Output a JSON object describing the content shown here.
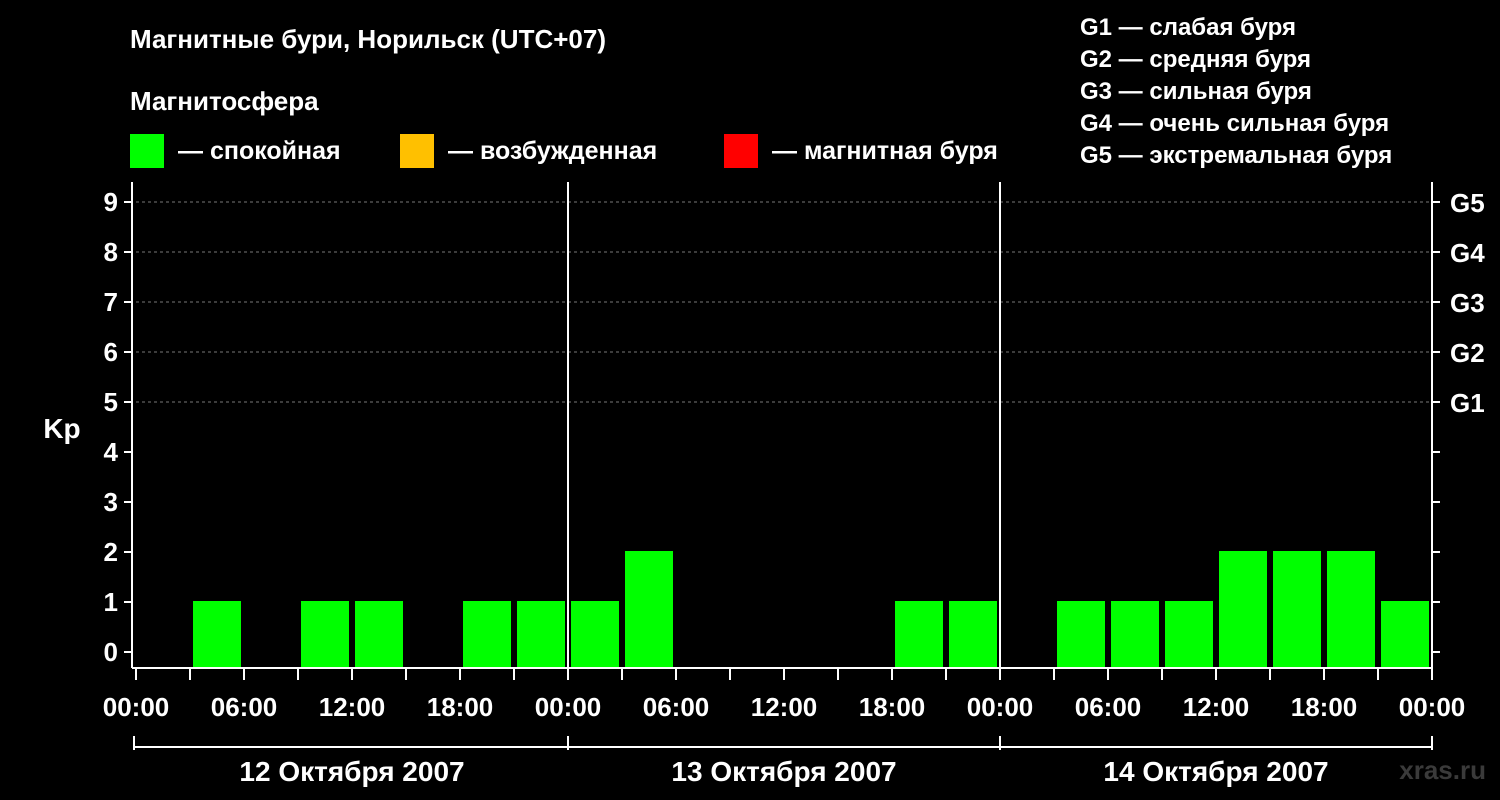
{
  "title": "Магнитные бури, Норильск (UTC+07)",
  "subtitle": "Магнитосфера",
  "legend": [
    {
      "label": "— спокойная",
      "color": "#00ff00"
    },
    {
      "label": "— возбужденная",
      "color": "#ffc000"
    },
    {
      "label": "— магнитная буря",
      "color": "#ff0000"
    }
  ],
  "g_scale": [
    "G1 — слабая буря",
    "G2 — средняя буря",
    "G3 — сильная буря",
    "G4 — очень сильная буря",
    "G5 — экстремальная буря"
  ],
  "watermark": "xras.ru",
  "chart_data": {
    "type": "bar",
    "ylabel": "Kp",
    "ylim": [
      0,
      9
    ],
    "yticks": [
      0,
      1,
      2,
      3,
      4,
      5,
      6,
      7,
      8,
      9
    ],
    "right_axis_labels": [
      {
        "kp": 5,
        "label": "G1"
      },
      {
        "kp": 6,
        "label": "G2"
      },
      {
        "kp": 7,
        "label": "G3"
      },
      {
        "kp": 8,
        "label": "G4"
      },
      {
        "kp": 9,
        "label": "G5"
      }
    ],
    "x_tick_labels": [
      "00:00",
      "06:00",
      "12:00",
      "18:00",
      "00:00",
      "06:00",
      "12:00",
      "18:00",
      "00:00",
      "06:00",
      "12:00",
      "18:00",
      "00:00"
    ],
    "days": [
      "12 Октября 2007",
      "13 Октября 2007",
      "14 Октября 2007"
    ],
    "interval_hours": 3,
    "values": [
      0,
      1,
      0,
      1,
      1,
      0,
      1,
      1,
      1,
      2,
      0,
      0,
      0,
      0,
      1,
      1,
      0,
      1,
      1,
      1,
      2,
      2,
      2,
      1
    ],
    "grid": "dashed horizontal at Kp 5–9",
    "colors": {
      "quiet": "#00ff00",
      "active": "#ffc000",
      "storm": "#ff0000"
    }
  }
}
